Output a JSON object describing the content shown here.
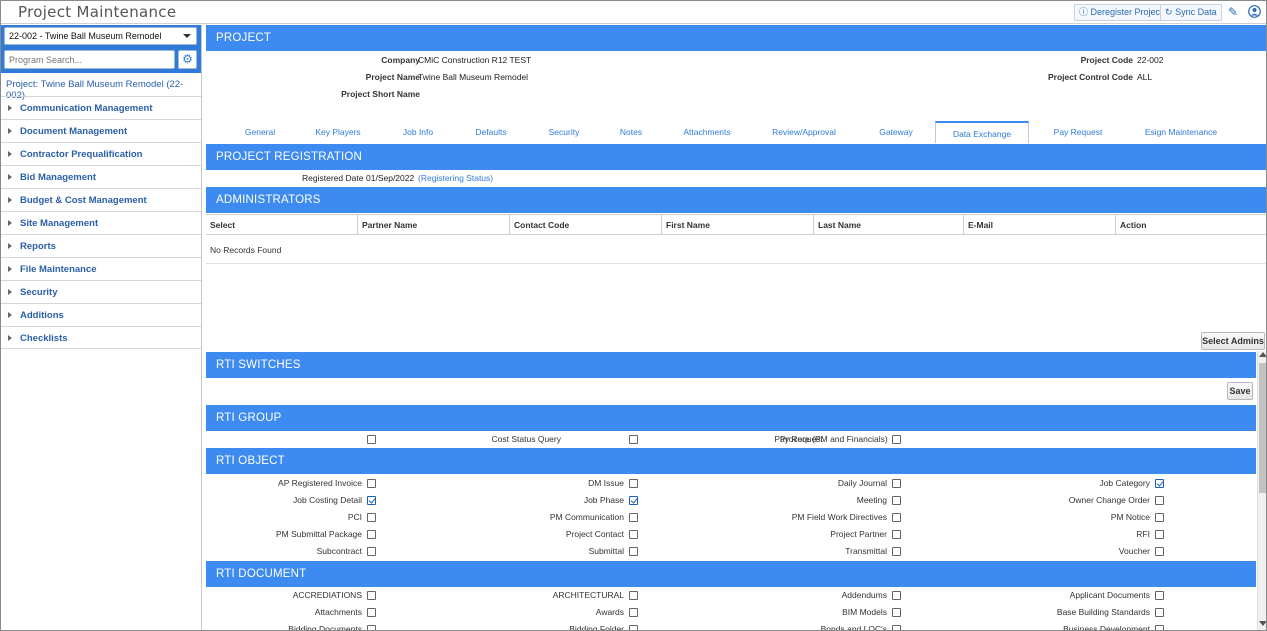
{
  "app": {
    "title": "Project Maintenance"
  },
  "toolbar": {
    "deregister": "Deregister Project",
    "sync": "Sync Data"
  },
  "sidebar": {
    "project_select": "22-002 - Twine Ball Museum Remodel",
    "search_placeholder": "Program Search...",
    "project_link": "Project: Twine Ball Museum Remodel (22-002)",
    "items": [
      {
        "label": "Communication Management"
      },
      {
        "label": "Document Management"
      },
      {
        "label": "Contractor Prequalification"
      },
      {
        "label": "Bid Management"
      },
      {
        "label": "Budget & Cost Management"
      },
      {
        "label": "Site Management"
      },
      {
        "label": "Reports"
      },
      {
        "label": "File Maintenance"
      },
      {
        "label": "Security"
      },
      {
        "label": "Additions"
      },
      {
        "label": "Checklists"
      }
    ]
  },
  "project": {
    "section": "PROJECT",
    "company_label": "Company",
    "company": "CMiC Construction R12 TEST",
    "name_label": "Project Name",
    "name": "Twine Ball Museum Remodel",
    "short_label": "Project Short Name",
    "short": "",
    "code_label": "Project Code",
    "code": "22-002",
    "control_label": "Project Control Code",
    "control": "ALL"
  },
  "tabs": [
    "General",
    "Key Players",
    "Job Info",
    "Defaults",
    "Security",
    "Notes",
    "Attachments",
    "Review/Approval",
    "Gateway",
    "Data Exchange",
    "Pay Request",
    "Esign Maintenance"
  ],
  "registration": {
    "section": "PROJECT REGISTRATION",
    "date_label": "Registered Date",
    "date": "01/Sep/2022",
    "status_link": "(Registering Status)"
  },
  "administrators": {
    "section": "ADMINISTRATORS",
    "columns": [
      "Select",
      "Partner Name",
      "Contact Code",
      "First Name",
      "Last Name",
      "E-Mail",
      "Action"
    ],
    "empty": "No Records Found",
    "select_button": "Select Admins"
  },
  "rti_switches": {
    "section": "RTI SWITCHES",
    "save": "Save"
  },
  "rti_group": {
    "section": "RTI GROUP",
    "items": [
      {
        "label": "Cost Status Query",
        "checked": false
      },
      {
        "label": "Pay Request",
        "checked": false
      },
      {
        "label": "Procore (PM and Financials)",
        "checked": false
      }
    ]
  },
  "rti_object": {
    "section": "RTI OBJECT",
    "items": [
      {
        "label": "AP Registered Invoice",
        "checked": false
      },
      {
        "label": "DM Issue",
        "checked": false
      },
      {
        "label": "Daily Journal",
        "checked": false
      },
      {
        "label": "Job Category",
        "checked": true
      },
      {
        "label": "Job Costing Detail",
        "checked": true
      },
      {
        "label": "Job Phase",
        "checked": true
      },
      {
        "label": "Meeting",
        "checked": false
      },
      {
        "label": "Owner Change Order",
        "checked": false
      },
      {
        "label": "PCI",
        "checked": false
      },
      {
        "label": "PM Communication",
        "checked": false
      },
      {
        "label": "PM Field Work Directives",
        "checked": false
      },
      {
        "label": "PM Notice",
        "checked": false
      },
      {
        "label": "PM Submittal Package",
        "checked": false
      },
      {
        "label": "Project Contact",
        "checked": false
      },
      {
        "label": "Project Partner",
        "checked": false
      },
      {
        "label": "RFI",
        "checked": false
      },
      {
        "label": "Subcontract",
        "checked": false
      },
      {
        "label": "Submittal",
        "checked": false
      },
      {
        "label": "Transmittal",
        "checked": false
      },
      {
        "label": "Voucher",
        "checked": false
      }
    ]
  },
  "rti_document": {
    "section": "RTI DOCUMENT",
    "items": [
      {
        "label": "ACCREDIATIONS",
        "checked": false
      },
      {
        "label": "ARCHITECTURAL",
        "checked": false
      },
      {
        "label": "Addendums",
        "checked": false
      },
      {
        "label": "Applicant Documents",
        "checked": false
      },
      {
        "label": "Attachments",
        "checked": false
      },
      {
        "label": "Awards",
        "checked": false
      },
      {
        "label": "BIM Models",
        "checked": false
      },
      {
        "label": "Base Building Standards",
        "checked": false
      },
      {
        "label": "Bidding Documents",
        "checked": false
      },
      {
        "label": "Bidding Folder",
        "checked": false
      },
      {
        "label": "Bonds and LOC's",
        "checked": false
      },
      {
        "label": "Business Development",
        "checked": false
      }
    ]
  }
}
